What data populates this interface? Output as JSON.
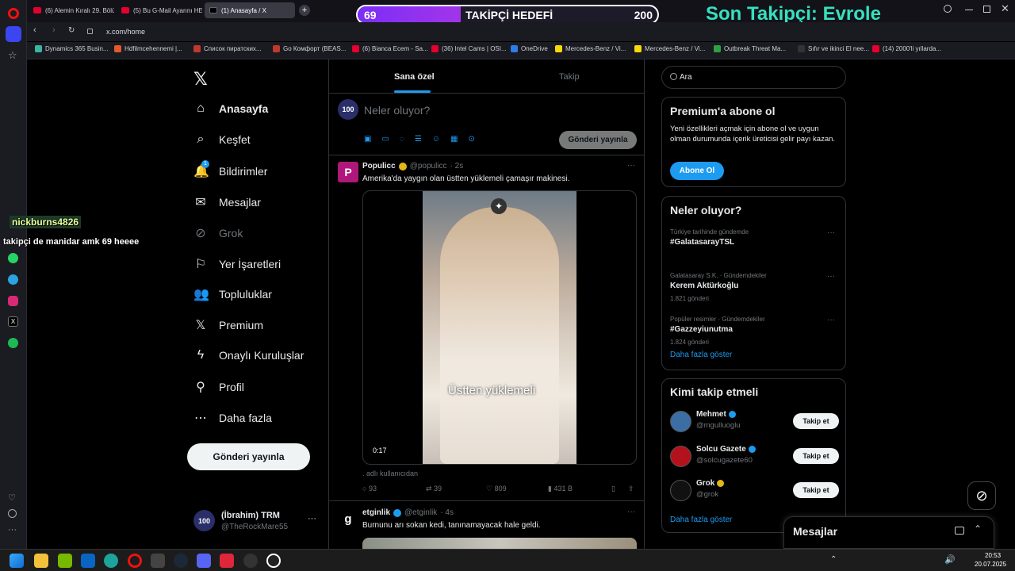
{
  "tabs": [
    {
      "title": "(6) Alemin Kıralı 29. Bölüm"
    },
    {
      "title": "(5) Bu G-Mail Ayarını HEM"
    },
    {
      "title": "(1) Anasayfa / X"
    }
  ],
  "address": {
    "url": "x.com/home"
  },
  "bookmarks": [
    "Dynamics 365 Busin...",
    "Hdfilmcehennemi |...",
    "Список пиратских...",
    "Go Комфорт (BEAS...",
    "(6) Bianca Ecem - Sa...",
    "(36) Intel Cams | OSI...",
    "OneDrive",
    "Mercedes-Benz / Vi...",
    "Mercedes-Benz / Vi...",
    "Outbreak Threat Ma...",
    "Sıfır ve ikinci El nee...",
    "(14) 2000'li yıllarda..."
  ],
  "overlay": {
    "goal_label": "TAKİPÇİ HEDEFİ",
    "goal_current": "69",
    "goal_target": "200",
    "goal_fraction": 0.345,
    "last_follower": "Son Takipçi: Evrole",
    "chat_user": "nickburns4826",
    "chat_message": "takipçi de manidar amk 69 heeee"
  },
  "nav": [
    {
      "label": "Anasayfa",
      "icon": "home-icon"
    },
    {
      "label": "Keşfet",
      "icon": "search-icon"
    },
    {
      "label": "Bildirimler",
      "icon": "bell-icon",
      "badge": "1"
    },
    {
      "label": "Mesajlar",
      "icon": "mail-icon"
    },
    {
      "label": "Grok",
      "icon": "grok-icon"
    },
    {
      "label": "Yer İşaretleri",
      "icon": "bookmark-icon"
    },
    {
      "label": "Topluluklar",
      "icon": "people-icon"
    },
    {
      "label": "Premium",
      "icon": "x-icon"
    },
    {
      "label": "Onaylı Kuruluşlar",
      "icon": "lightning-icon"
    },
    {
      "label": "Profil",
      "icon": "person-icon"
    },
    {
      "label": "Daha fazla",
      "icon": "more-icon"
    }
  ],
  "post_button": "Gönderi yayınla",
  "account": {
    "name": "(İbrahim) TRM",
    "handle": "@TheRockMare55",
    "avatar_text": "100"
  },
  "feed": {
    "tabs": [
      "Sana özel",
      "Takip"
    ],
    "compose_placeholder": "Neler oluyor?",
    "compose_button": "Gönderi yayınla",
    "posts": [
      {
        "name": "Populicc",
        "handle": "@populicc",
        "time": "· 2s",
        "text": "Amerika'da yaygın olan üstten yüklemeli çamaşır makinesi.",
        "video_caption": "Üstten yüklemeli",
        "duration": "0:17",
        "source": ". adlı kullanıcıdan",
        "replies": "93",
        "reposts": "39",
        "likes": "809",
        "views": "431 B"
      },
      {
        "name": "etginlik",
        "handle": "@etginlik",
        "time": "· 4s",
        "text": "Burnunu arı sokan kedi, tanınamayacak hale geldi."
      }
    ]
  },
  "search": {
    "placeholder": "Ara"
  },
  "premium": {
    "title": "Premium'a abone ol",
    "body": "Yeni özellikleri açmak için abone ol ve uygun olman durumunda içerik üreticisi gelir payı kazan.",
    "button": "Abone Ol"
  },
  "trends": {
    "title": "Neler oluyor?",
    "items": [
      {
        "context": "Türkiye tarihinde gündemde",
        "name": "#GalatasarayTSL",
        "count": ""
      },
      {
        "context": "Galatasaray S.K. · Gündemdekiler",
        "name": "Kerem Aktürkoğlu",
        "count": "1.821 gönderi"
      },
      {
        "context": "Popüler resimler · Gündemdekiler",
        "name": "#Gazzeyiunutma",
        "count": "1.824 gönderi"
      }
    ],
    "more": "Daha fazla göster"
  },
  "who_to_follow": {
    "title": "Kimi takip etmeli",
    "items": [
      {
        "name": "Mehmet",
        "handle": "@mgulluoglu",
        "button": "Takip et"
      },
      {
        "name": "Solcu Gazete",
        "handle": "@solcugazete60",
        "button": "Takip et"
      },
      {
        "name": "Grok",
        "handle": "@grok",
        "button": "Takip et"
      }
    ],
    "more": "Daha fazla göster"
  },
  "messages_drawer": {
    "title": "Mesajlar"
  },
  "taskbar": {
    "time": "20:53",
    "date": "20.07.2025"
  },
  "colors": {
    "accent": "#1d9bf0",
    "bg": "#000000",
    "border": "#2f3336",
    "muted": "#71767b",
    "goal_fill": "#8a2be2",
    "follower_text": "#36e0c0"
  }
}
